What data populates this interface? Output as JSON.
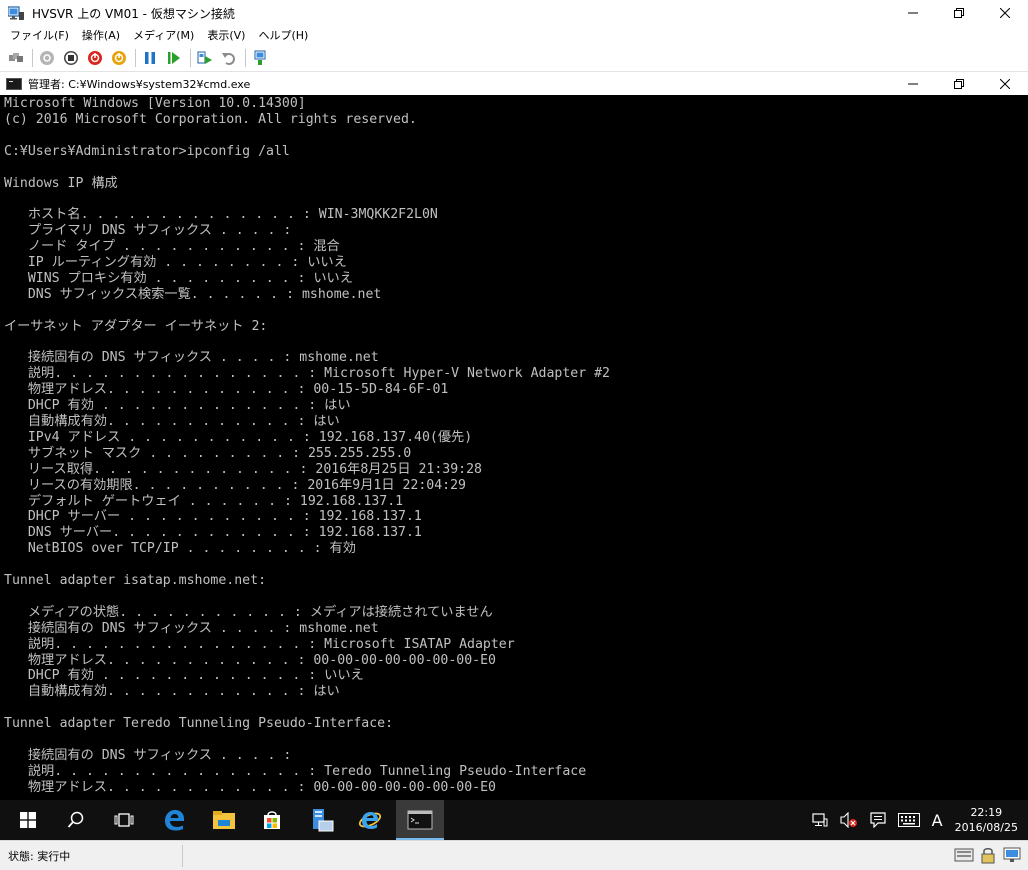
{
  "vm_window": {
    "title": "HVSVR 上の VM01 - 仮想マシン接続",
    "minimize_label": "—",
    "maximize_label": "❐",
    "close_label": "✕"
  },
  "menu": {
    "items": [
      "ファイル(F)",
      "操作(A)",
      "メディア(M)",
      "表示(V)",
      "ヘルプ(H)"
    ]
  },
  "toolbar": {
    "icons": [
      "ctrl-alt-del-icon",
      "start-icon",
      "turn-off-icon",
      "shutdown-icon",
      "power-icon",
      "pause-icon",
      "resume-icon",
      "checkpoint-icon",
      "revert-icon",
      "enhanced-session-icon"
    ],
    "colors": {
      "red": "#d9261c",
      "orange": "#e8a20c",
      "blue": "#1d73c9",
      "green": "#2aa02a",
      "gray": "#8c8c8c"
    }
  },
  "cmd_window": {
    "title": "管理者: C:¥Windows¥system32¥cmd.exe",
    "minimize_label": "—",
    "maximize_label": "❐",
    "close_label": "✕"
  },
  "console": {
    "background": "#000000",
    "foreground": "#c0c0c0",
    "lines": [
      "Microsoft Windows [Version 10.0.14300]",
      "(c) 2016 Microsoft Corporation. All rights reserved.",
      "",
      "C:¥Users¥Administrator>ipconfig /all",
      "",
      "Windows IP 構成",
      "",
      "   ホスト名. . . . . . . . . . . . . . : WIN-3MQKK2F2L0N",
      "   プライマリ DNS サフィックス . . . . :",
      "   ノード タイプ . . . . . . . . . . . : 混合",
      "   IP ルーティング有効 . . . . . . . . : いいえ",
      "   WINS プロキシ有効 . . . . . . . . . : いいえ",
      "   DNS サフィックス検索一覧. . . . . . : mshome.net",
      "",
      "イーサネット アダプター イーサネット 2:",
      "",
      "   接続固有の DNS サフィックス . . . . : mshome.net",
      "   説明. . . . . . . . . . . . . . . . : Microsoft Hyper-V Network Adapter #2",
      "   物理アドレス. . . . . . . . . . . . : 00-15-5D-84-6F-01",
      "   DHCP 有効 . . . . . . . . . . . . . : はい",
      "   自動構成有効. . . . . . . . . . . . : はい",
      "   IPv4 アドレス . . . . . . . . . . . : 192.168.137.40(優先)",
      "   サブネット マスク . . . . . . . . . : 255.255.255.0",
      "   リース取得. . . . . . . . . . . . . : 2016年8月25日 21:39:28",
      "   リースの有効期限. . . . . . . . . . : 2016年9月1日 22:04:29",
      "   デフォルト ゲートウェイ . . . . . . : 192.168.137.1",
      "   DHCP サーバー . . . . . . . . . . . : 192.168.137.1",
      "   DNS サーバー. . . . . . . . . . . . : 192.168.137.1",
      "   NetBIOS over TCP/IP . . . . . . . . : 有効",
      "",
      "Tunnel adapter isatap.mshome.net:",
      "",
      "   メディアの状態. . . . . . . . . . . : メディアは接続されていません",
      "   接続固有の DNS サフィックス . . . . : mshome.net",
      "   説明. . . . . . . . . . . . . . . . : Microsoft ISATAP Adapter",
      "   物理アドレス. . . . . . . . . . . . : 00-00-00-00-00-00-00-E0",
      "   DHCP 有効 . . . . . . . . . . . . . : いいえ",
      "   自動構成有効. . . . . . . . . . . . : はい",
      "",
      "Tunnel adapter Teredo Tunneling Pseudo-Interface:",
      "",
      "   接続固有の DNS サフィックス . . . . :",
      "   説明. . . . . . . . . . . . . . . . : Teredo Tunneling Pseudo-Interface",
      "   物理アドレス. . . . . . . . . . . . : 00-00-00-00-00-00-00-E0"
    ]
  },
  "taskbar": {
    "items": [
      "start-icon",
      "search-icon",
      "task-view-icon",
      "edge-icon",
      "file-explorer-icon",
      "store-icon",
      "server-manager-icon",
      "internet-explorer-icon",
      "command-prompt-icon"
    ],
    "active_item": "command-prompt-icon",
    "tray": {
      "ime_label": "A",
      "time": "22:19",
      "date": "2016/08/25"
    }
  },
  "status_bar": {
    "text": "状態: 実行中"
  }
}
